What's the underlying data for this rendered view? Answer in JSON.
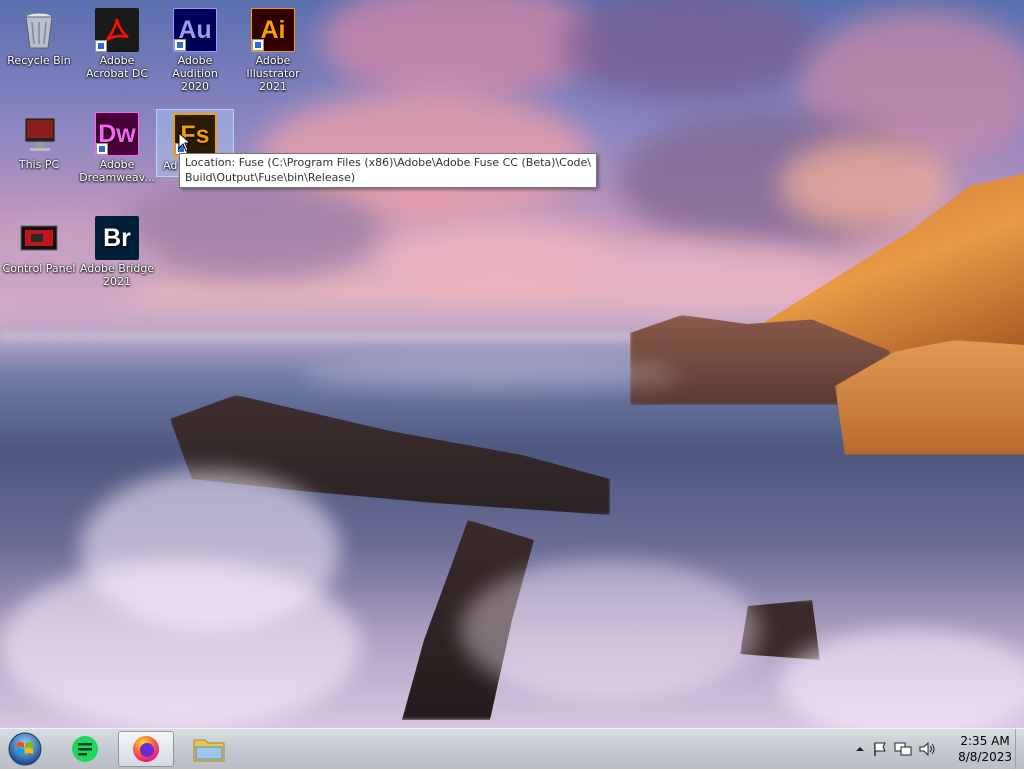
{
  "desktop_icons": [
    {
      "label": "Recycle Bin",
      "icon": "recycle-bin-icon"
    },
    {
      "label": "Adobe Acrobat DC",
      "icon": "acrobat-icon"
    },
    {
      "label": "Adobe Audition 2020",
      "icon": "audition-icon",
      "abbr": "Au"
    },
    {
      "label": "Adobe Illustrator 2021",
      "icon": "illustrator-icon",
      "abbr": "Ai"
    },
    {
      "label": "This PC",
      "icon": "this-pc-icon"
    },
    {
      "label": "Adobe Dreamweav...",
      "icon": "dreamweaver-icon",
      "abbr": "Dw"
    },
    {
      "label": "Adobe Fuse",
      "visible_label": "Ad",
      "icon": "fuse-icon",
      "abbr": "Fs",
      "selected": true
    },
    {
      "label": "Control Panel",
      "icon": "control-panel-icon"
    },
    {
      "label": "Adobe Bridge 2021",
      "icon": "bridge-icon",
      "abbr": "Br"
    }
  ],
  "tooltip": {
    "line1": "Location: Fuse (C:\\Program Files (x86)\\Adobe\\Adobe Fuse CC (Beta)\\Code\\",
    "line2": "Build\\Output\\Fuse\\bin\\Release)"
  },
  "taskbar": {
    "items": [
      {
        "name": "start-button",
        "icon": "windows-orb-icon"
      },
      {
        "name": "app-green",
        "icon": "notes-app-icon"
      },
      {
        "name": "firefox",
        "icon": "firefox-icon",
        "active": true
      },
      {
        "name": "explorer",
        "icon": "folder-icon"
      }
    ],
    "tray_icons": [
      "show-hidden-icons-arrow",
      "action-center-flag-icon",
      "network-icon",
      "volume-icon"
    ],
    "time": "2:35 AM",
    "date": "8/8/2023"
  },
  "colors": {
    "acrobat_bg": "#1a1a1a",
    "audition_bg": "#00005b",
    "audition_fg": "#9999ff",
    "illustrator_bg": "#330000",
    "illustrator_fg": "#ff9a00",
    "dreamweaver_bg": "#470137",
    "dreamweaver_fg": "#ff61f6",
    "fuse_bg": "#2b1d05",
    "fuse_fg": "#f39c12",
    "bridge_bg": "#001e36",
    "bridge_fg": "#ffffff"
  }
}
